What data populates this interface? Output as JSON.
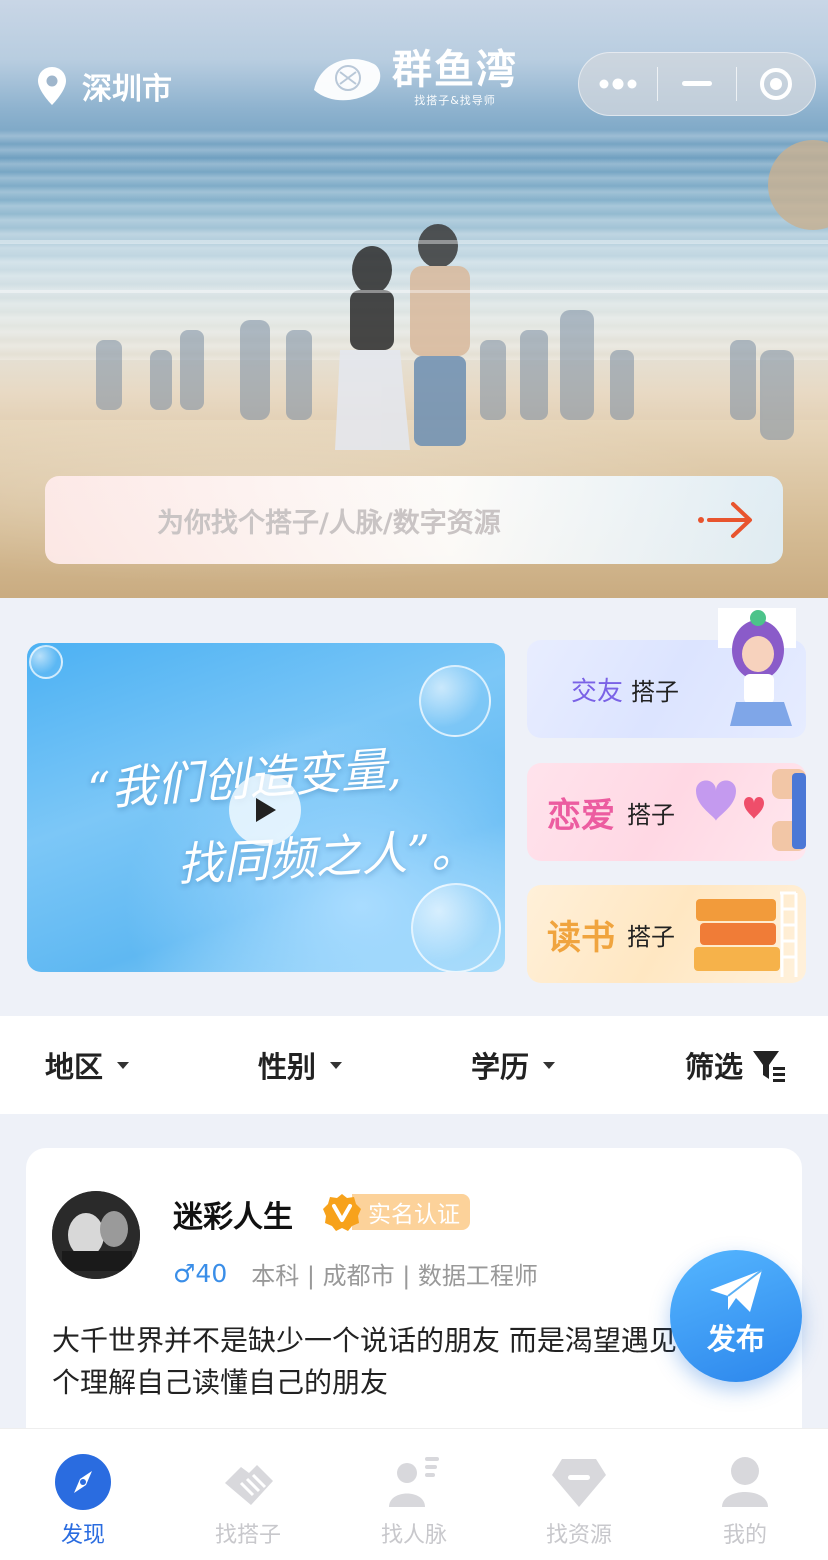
{
  "header": {
    "city": "深圳市",
    "logo_name": "群鱼湾",
    "logo_sub": "找搭子&找导师"
  },
  "search": {
    "placeholder": "为你找个搭子/人脉/数字资源"
  },
  "promo": {
    "video_line1": "“我们创造变量,",
    "video_line2": "找同频之人”。",
    "cards": [
      {
        "keyword": "交友",
        "label": "搭子"
      },
      {
        "keyword": "恋爱",
        "label": "搭子"
      },
      {
        "keyword": "读书",
        "label": "搭子"
      }
    ]
  },
  "filters": {
    "region": "地区",
    "gender": "性别",
    "education": "学历",
    "screen": "筛选"
  },
  "post": {
    "username": "迷彩人生",
    "badge": "实名认证",
    "gender_age": "♂40",
    "details": "本科 | 成都市 | 数据工程师",
    "content": "大千世界并不是缺少一个说话的朋友 而是渴望遇见一个理解自己读懂自己的朋友"
  },
  "fab": {
    "label": "发布"
  },
  "tabs": [
    {
      "label": "发现",
      "icon": "compass-icon",
      "active": true
    },
    {
      "label": "找搭子",
      "icon": "handshake-icon",
      "active": false
    },
    {
      "label": "找人脉",
      "icon": "person-card-icon",
      "active": false
    },
    {
      "label": "找资源",
      "icon": "gem-icon",
      "active": false
    },
    {
      "label": "我的",
      "icon": "user-icon",
      "active": false
    }
  ],
  "colors": {
    "accent": "#2a6ce0",
    "fab": "#3a97f0",
    "badge": "#fcd29a",
    "gender": "#3a8ee8",
    "search_arrow": "#e8542e"
  }
}
